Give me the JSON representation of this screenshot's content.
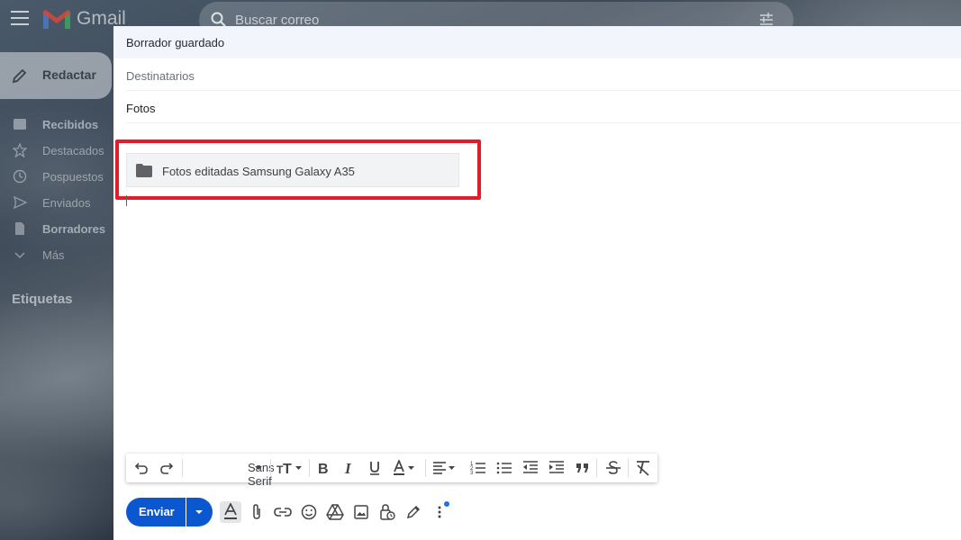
{
  "app": {
    "name": "Gmail",
    "accent_color": "#0b57d0",
    "highlight_color": "#e21c2a"
  },
  "topbar": {
    "search_placeholder": "Buscar correo"
  },
  "sidebar": {
    "compose_label": "Redactar",
    "items": [
      {
        "label": "Recibidos",
        "icon": "inbox-icon",
        "bold": true
      },
      {
        "label": "Destacados",
        "icon": "star-icon",
        "bold": false
      },
      {
        "label": "Pospuestos",
        "icon": "clock-icon",
        "bold": false
      },
      {
        "label": "Enviados",
        "icon": "send-icon",
        "bold": false
      },
      {
        "label": "Borradores",
        "icon": "draft-icon",
        "bold": true
      },
      {
        "label": "Más",
        "icon": "chevron-down-icon",
        "bold": false
      }
    ],
    "labels_heading": "Etiquetas"
  },
  "compose": {
    "status": "Borrador guardado",
    "recipients_placeholder": "Destinatarios",
    "subject_value": "Fotos",
    "attachment": {
      "name": "Fotos editadas Samsung Galaxy A35",
      "icon": "folder-icon"
    },
    "toolbar": {
      "font": "Sans Serif"
    },
    "send_label": "Enviar"
  }
}
